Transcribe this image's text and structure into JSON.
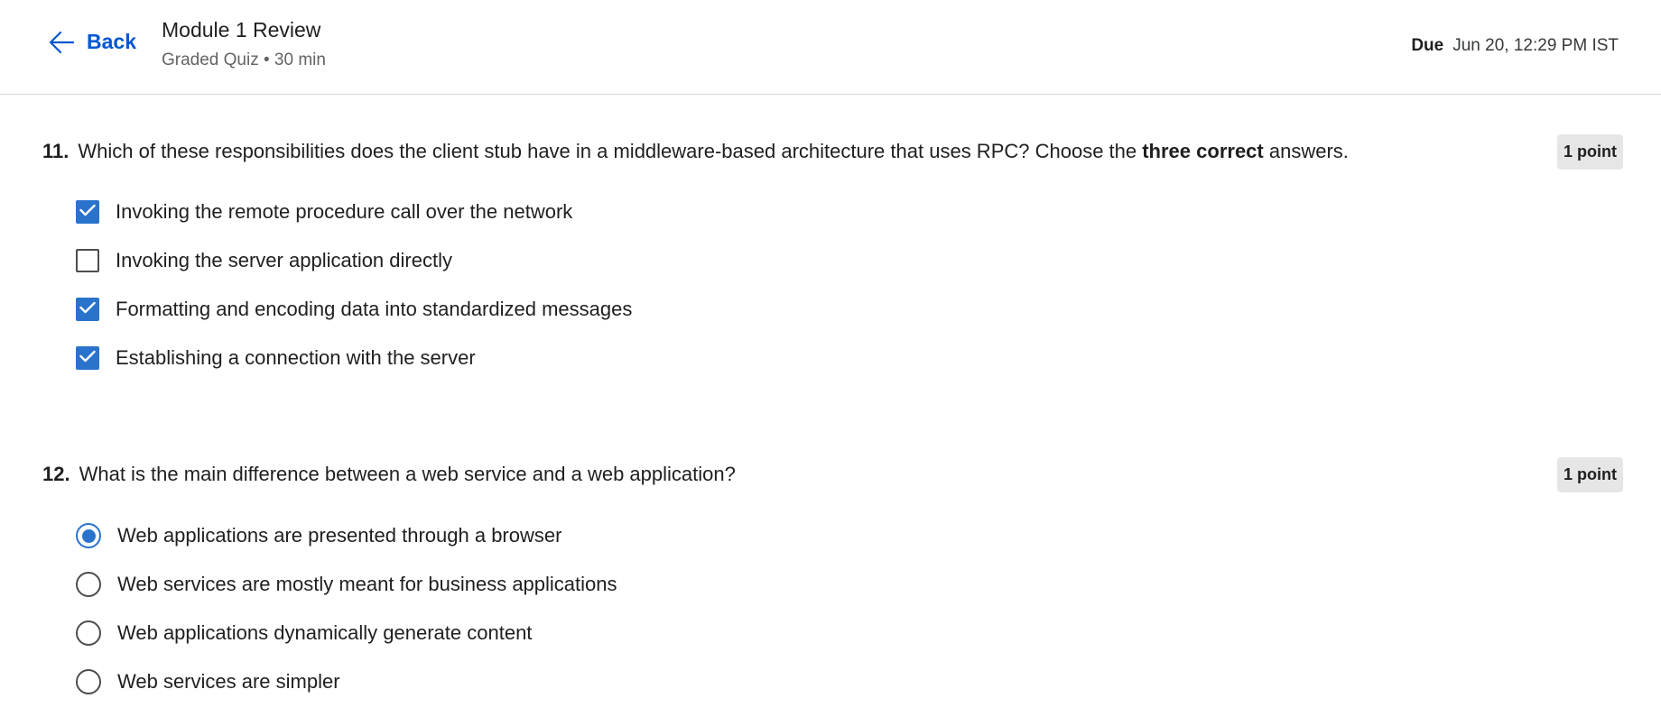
{
  "header": {
    "back_label": "Back",
    "title": "Module 1 Review",
    "subtitle": "Graded Quiz • 30 min",
    "due_label": "Due",
    "due_value": "Jun 20, 12:29 PM IST"
  },
  "questions": [
    {
      "number": "11.",
      "text_before": "Which of these responsibilities does the client stub have in a middleware-based architecture that uses RPC? Choose the ",
      "text_bold": "three correct",
      "text_after": " answers.",
      "points": "1 point",
      "input_type": "checkbox",
      "options": [
        {
          "label": "Invoking the remote procedure call over the network",
          "selected": true
        },
        {
          "label": "Invoking the server application directly",
          "selected": false
        },
        {
          "label": "Formatting and encoding data into standardized messages",
          "selected": true
        },
        {
          "label": "Establishing a connection with the server",
          "selected": true
        }
      ]
    },
    {
      "number": "12.",
      "text_before": "What is the main difference between a web service and a web application?",
      "text_bold": "",
      "text_after": "",
      "points": "1 point",
      "input_type": "radio",
      "options": [
        {
          "label": "Web applications are presented through a browser",
          "selected": true
        },
        {
          "label": "Web services are mostly meant for business applications",
          "selected": false
        },
        {
          "label": "Web applications dynamically generate content",
          "selected": false
        },
        {
          "label": "Web services are simpler",
          "selected": false
        }
      ]
    }
  ],
  "colors": {
    "accent": "#0056d2",
    "selected": "#2a73cc",
    "badge_bg": "#e6e6e6"
  },
  "icons": {
    "back": "arrow-left-icon",
    "check": "checkmark-icon"
  }
}
